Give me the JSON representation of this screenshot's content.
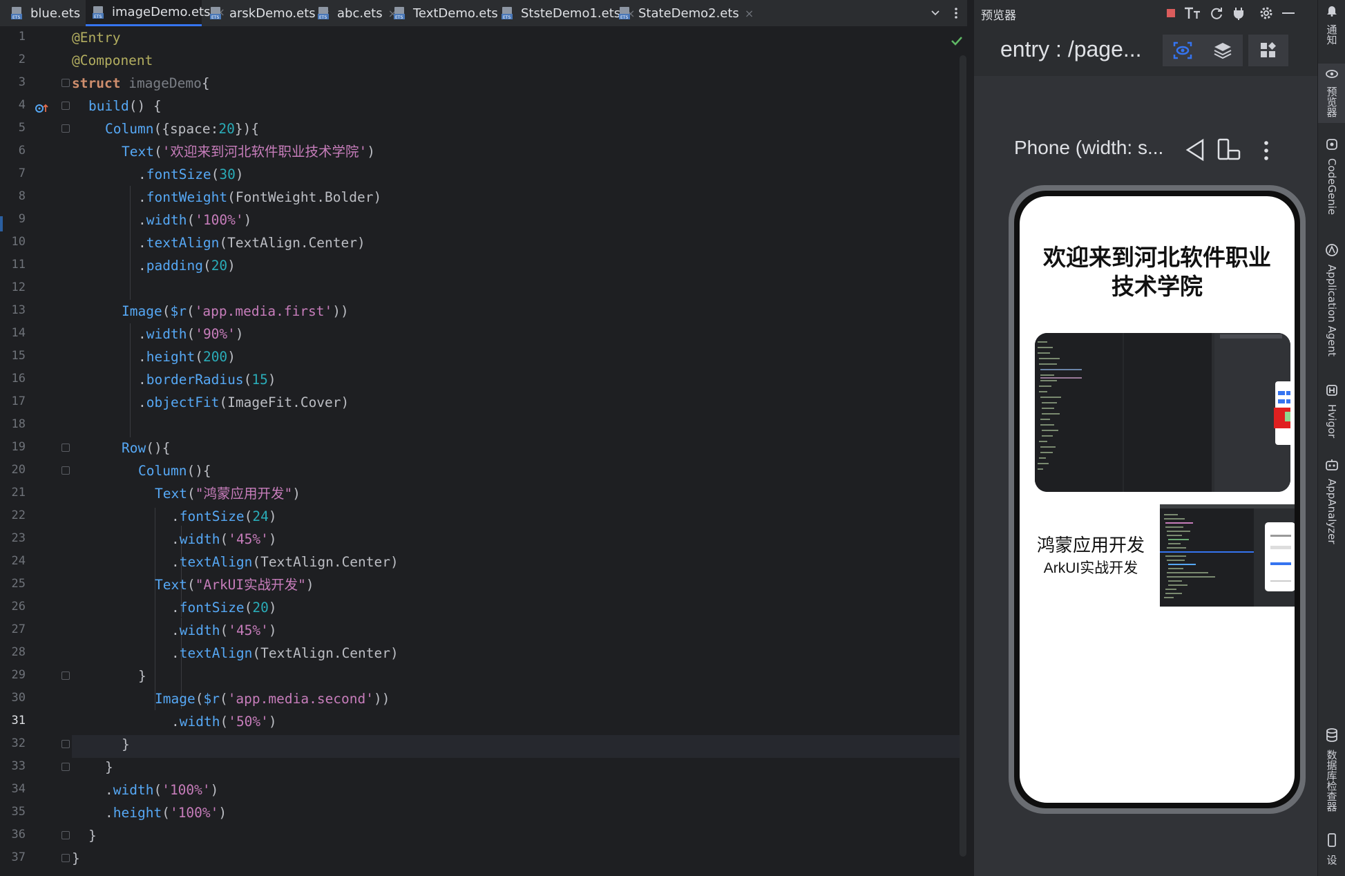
{
  "tabs": [
    {
      "label": "blue.ets",
      "active": false
    },
    {
      "label": "imageDemo.ets",
      "active": true
    },
    {
      "label": "arskDemo.ets",
      "active": false
    },
    {
      "label": "abc.ets",
      "active": false
    },
    {
      "label": "TextDemo.ets",
      "active": false
    },
    {
      "label": "StsteDemo1.ets",
      "active": false
    },
    {
      "label": "StateDemo2.ets",
      "active": false
    }
  ],
  "tab_close_glyph": "×",
  "tab_icon": "ets-file-icon",
  "editor": {
    "current_line": 31,
    "line_numbers": [
      "1",
      "2",
      "3",
      "4",
      "5",
      "6",
      "7",
      "8",
      "9",
      "10",
      "11",
      "12",
      "13",
      "14",
      "15",
      "16",
      "17",
      "18",
      "19",
      "20",
      "21",
      "22",
      "23",
      "24",
      "25",
      "26",
      "27",
      "28",
      "29",
      "30",
      "31",
      "32",
      "33",
      "34",
      "35",
      "36",
      "37"
    ],
    "code": {
      "l1": "@Entry",
      "l2": "@Component",
      "l3_kw": "struct",
      "l3_name": "imageDemo",
      "l3_brace": "{",
      "l4_fn": "build",
      "l4_rest": "() {",
      "l5_fn": "Column",
      "l5_open": "({",
      "l5_key": "space",
      "l5_colon": ":",
      "l5_num": "20",
      "l5_close": "}){",
      "l6_fn": "Text",
      "l6_open": "(",
      "l6_str": "'欢迎来到河北软件职业技术学院'",
      "l6_close": ")",
      "l7_dot": ".",
      "l7_fn": "fontSize",
      "l7_open": "(",
      "l7_num": "30",
      "l7_close": ")",
      "l8_fn": "fontWeight",
      "l8_arg": "FontWeight.Bolder",
      "l9_fn": "width",
      "l9_str": "'100%'",
      "l10_fn": "textAlign",
      "l10_arg": "TextAlign.Center",
      "l11_fn": "padding",
      "l11_num": "20",
      "l13_fn": "Image",
      "l13_r": "$r",
      "l13_str": "'app.media.first'",
      "l14_fn": "width",
      "l14_str": "'90%'",
      "l15_fn": "height",
      "l15_num": "200",
      "l16_fn": "borderRadius",
      "l16_num": "15",
      "l17_fn": "objectFit",
      "l17_arg": "ImageFit.Cover",
      "l19_fn": "Row",
      "l19_rest": "(){",
      "l20_fn": "Column",
      "l20_rest": "(){",
      "l21_fn": "Text",
      "l21_str": "\"鸿蒙应用开发\"",
      "l22_fn": "fontSize",
      "l22_num": "24",
      "l23_fn": "width",
      "l23_str": "'45%'",
      "l24_fn": "textAlign",
      "l24_arg": "TextAlign.Center",
      "l25_fn": "Text",
      "l25_str": "\"ArkUI实战开发\"",
      "l26_fn": "fontSize",
      "l26_num": "20",
      "l27_fn": "width",
      "l27_str": "'45%'",
      "l28_fn": "textAlign",
      "l28_arg": "TextAlign.Center",
      "l29": "}",
      "l30_fn": "Image",
      "l30_r": "$r",
      "l30_str": "'app.media.second'",
      "l31_fn": "width",
      "l31_str": "'50%'",
      "l32": "}",
      "l33": "}",
      "l34_fn": "width",
      "l34_str": "'100%'",
      "l35_fn": "height",
      "l35_str": "'100%'",
      "l36": "}",
      "l37": "}"
    }
  },
  "preview": {
    "title": "预览器",
    "entry_label": "entry : /page...",
    "device_label": "Phone (width: s...",
    "app": {
      "title": "欢迎来到河北软件职业技术学院",
      "row_text1": "鸿蒙应用开发",
      "row_text2": "ArkUI实战开发"
    }
  },
  "right_strip": [
    {
      "label": "通知",
      "icon": "bell-icon"
    },
    {
      "label": "预览器",
      "icon": "eye-icon",
      "active": true
    },
    {
      "label": "CodeGenie",
      "icon": "codegenie-icon"
    },
    {
      "label": "Application Agent",
      "icon": "agent-icon"
    },
    {
      "label": "Hvigor",
      "icon": "hvigor-icon"
    },
    {
      "label": "AppAnalyzer",
      "icon": "analyzer-icon"
    },
    {
      "label": "数据库检查器",
      "icon": "database-icon"
    },
    {
      "label": "设",
      "icon": "device-icon"
    }
  ],
  "colors": {
    "accent": "#3574f0",
    "editor_bg": "#1e1f22",
    "panel_bg": "#2b2d30"
  }
}
